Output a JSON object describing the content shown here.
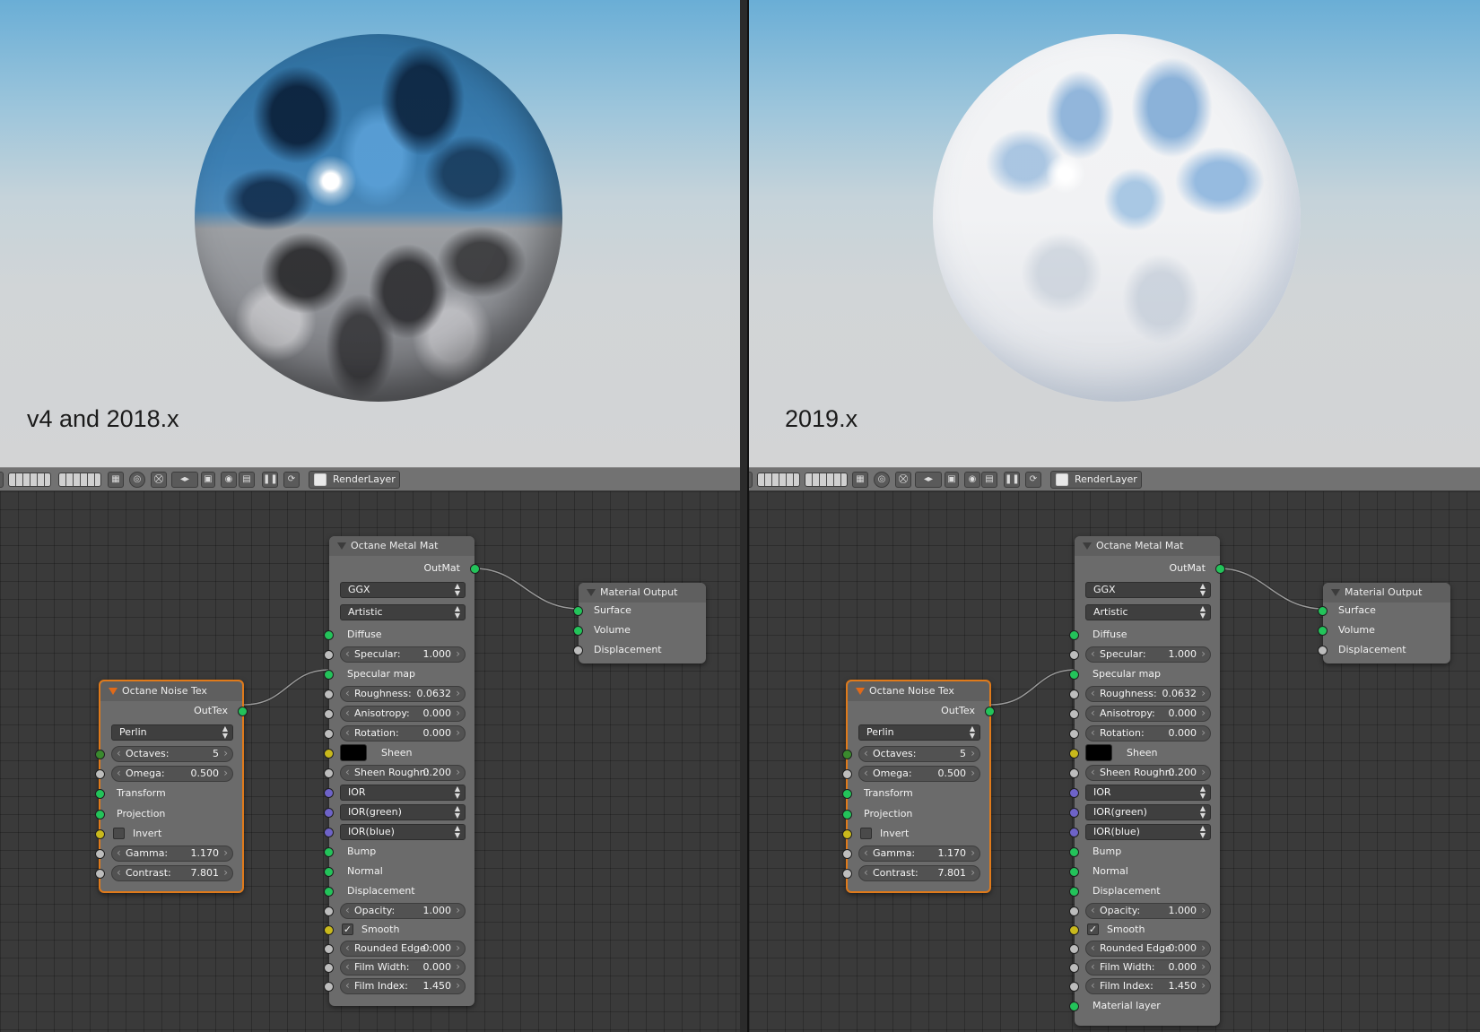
{
  "left": {
    "render_label": "v4 and 2018.x",
    "toolbar": {
      "render_layer": "RenderLayer"
    },
    "noise_node": {
      "title": "Octane Noise Tex",
      "output": "OutTex",
      "type": "Perlin",
      "octaves_label": "Octaves:",
      "octaves_value": "5",
      "omega_label": "Omega:",
      "omega_value": "0.500",
      "transform": "Transform",
      "projection": "Projection",
      "invert": "Invert",
      "gamma_label": "Gamma:",
      "gamma_value": "1.170",
      "contrast_label": "Contrast:",
      "contrast_value": "7.801"
    },
    "metal_node": {
      "title": "Octane Metal Mat",
      "output": "OutMat",
      "brdf": "GGX",
      "mode": "Artistic",
      "diffuse": "Diffuse",
      "specular_label": "Specular:",
      "specular_value": "1.000",
      "specular_map": "Specular map",
      "roughness_label": "Roughness:",
      "roughness_value": "0.0632",
      "anisotropy_label": "Anisotropy:",
      "anisotropy_value": "0.000",
      "rotation_label": "Rotation:",
      "rotation_value": "0.000",
      "sheen": "Sheen",
      "sheen_rough_label": "Sheen Roughn:",
      "sheen_rough_value": "0.200",
      "ior": "IOR",
      "ior_green": "IOR(green)",
      "ior_blue": "IOR(blue)",
      "bump": "Bump",
      "normal": "Normal",
      "displacement": "Displacement",
      "opacity_label": "Opacity:",
      "opacity_value": "1.000",
      "smooth": "Smooth",
      "rounded_edge_label": "Rounded Edge :",
      "rounded_edge_value": "0.000",
      "film_width_label": "Film Width:",
      "film_width_value": "0.000",
      "film_index_label": "Film Index:",
      "film_index_value": "1.450"
    },
    "output_node": {
      "title": "Material Output",
      "surface": "Surface",
      "volume": "Volume",
      "displacement": "Displacement"
    }
  },
  "right": {
    "render_label": "2019.x",
    "toolbar": {
      "render_layer": "RenderLayer"
    },
    "noise_node": {
      "title": "Octane Noise Tex",
      "output": "OutTex",
      "type": "Perlin",
      "octaves_label": "Octaves:",
      "octaves_value": "5",
      "omega_label": "Omega:",
      "omega_value": "0.500",
      "transform": "Transform",
      "projection": "Projection",
      "invert": "Invert",
      "gamma_label": "Gamma:",
      "gamma_value": "1.170",
      "contrast_label": "Contrast:",
      "contrast_value": "7.801"
    },
    "metal_node": {
      "title": "Octane Metal Mat",
      "output": "OutMat",
      "brdf": "GGX",
      "mode": "Artistic",
      "diffuse": "Diffuse",
      "specular_label": "Specular:",
      "specular_value": "1.000",
      "specular_map": "Specular map",
      "roughness_label": "Roughness:",
      "roughness_value": "0.0632",
      "anisotropy_label": "Anisotropy:",
      "anisotropy_value": "0.000",
      "rotation_label": "Rotation:",
      "rotation_value": "0.000",
      "sheen": "Sheen",
      "sheen_rough_label": "Sheen Roughn:",
      "sheen_rough_value": "0.200",
      "ior": "IOR",
      "ior_green": "IOR(green)",
      "ior_blue": "IOR(blue)",
      "bump": "Bump",
      "normal": "Normal",
      "displacement": "Displacement",
      "opacity_label": "Opacity:",
      "opacity_value": "1.000",
      "smooth": "Smooth",
      "rounded_edge_label": "Rounded Edge :",
      "rounded_edge_value": "0.000",
      "film_width_label": "Film Width:",
      "film_width_value": "0.000",
      "film_index_label": "Film Index:",
      "film_index_value": "1.450",
      "material_layer": "Material layer"
    },
    "output_node": {
      "title": "Material Output",
      "surface": "Surface",
      "volume": "Volume",
      "displacement": "Displacement"
    }
  },
  "colors": {
    "socket_green": "#23c35a",
    "socket_grey": "#bdbdbd",
    "socket_yellow": "#c9b91c",
    "socket_purple": "#6e63c8",
    "selected_outline": "#e07a1a",
    "node_body": "#6b6b6b",
    "editor_bg": "#3a3a3a"
  },
  "icons": [
    "render-layer-icon",
    "view-grid-icon",
    "camera-icon",
    "refresh-icon",
    "pause-icon"
  ]
}
